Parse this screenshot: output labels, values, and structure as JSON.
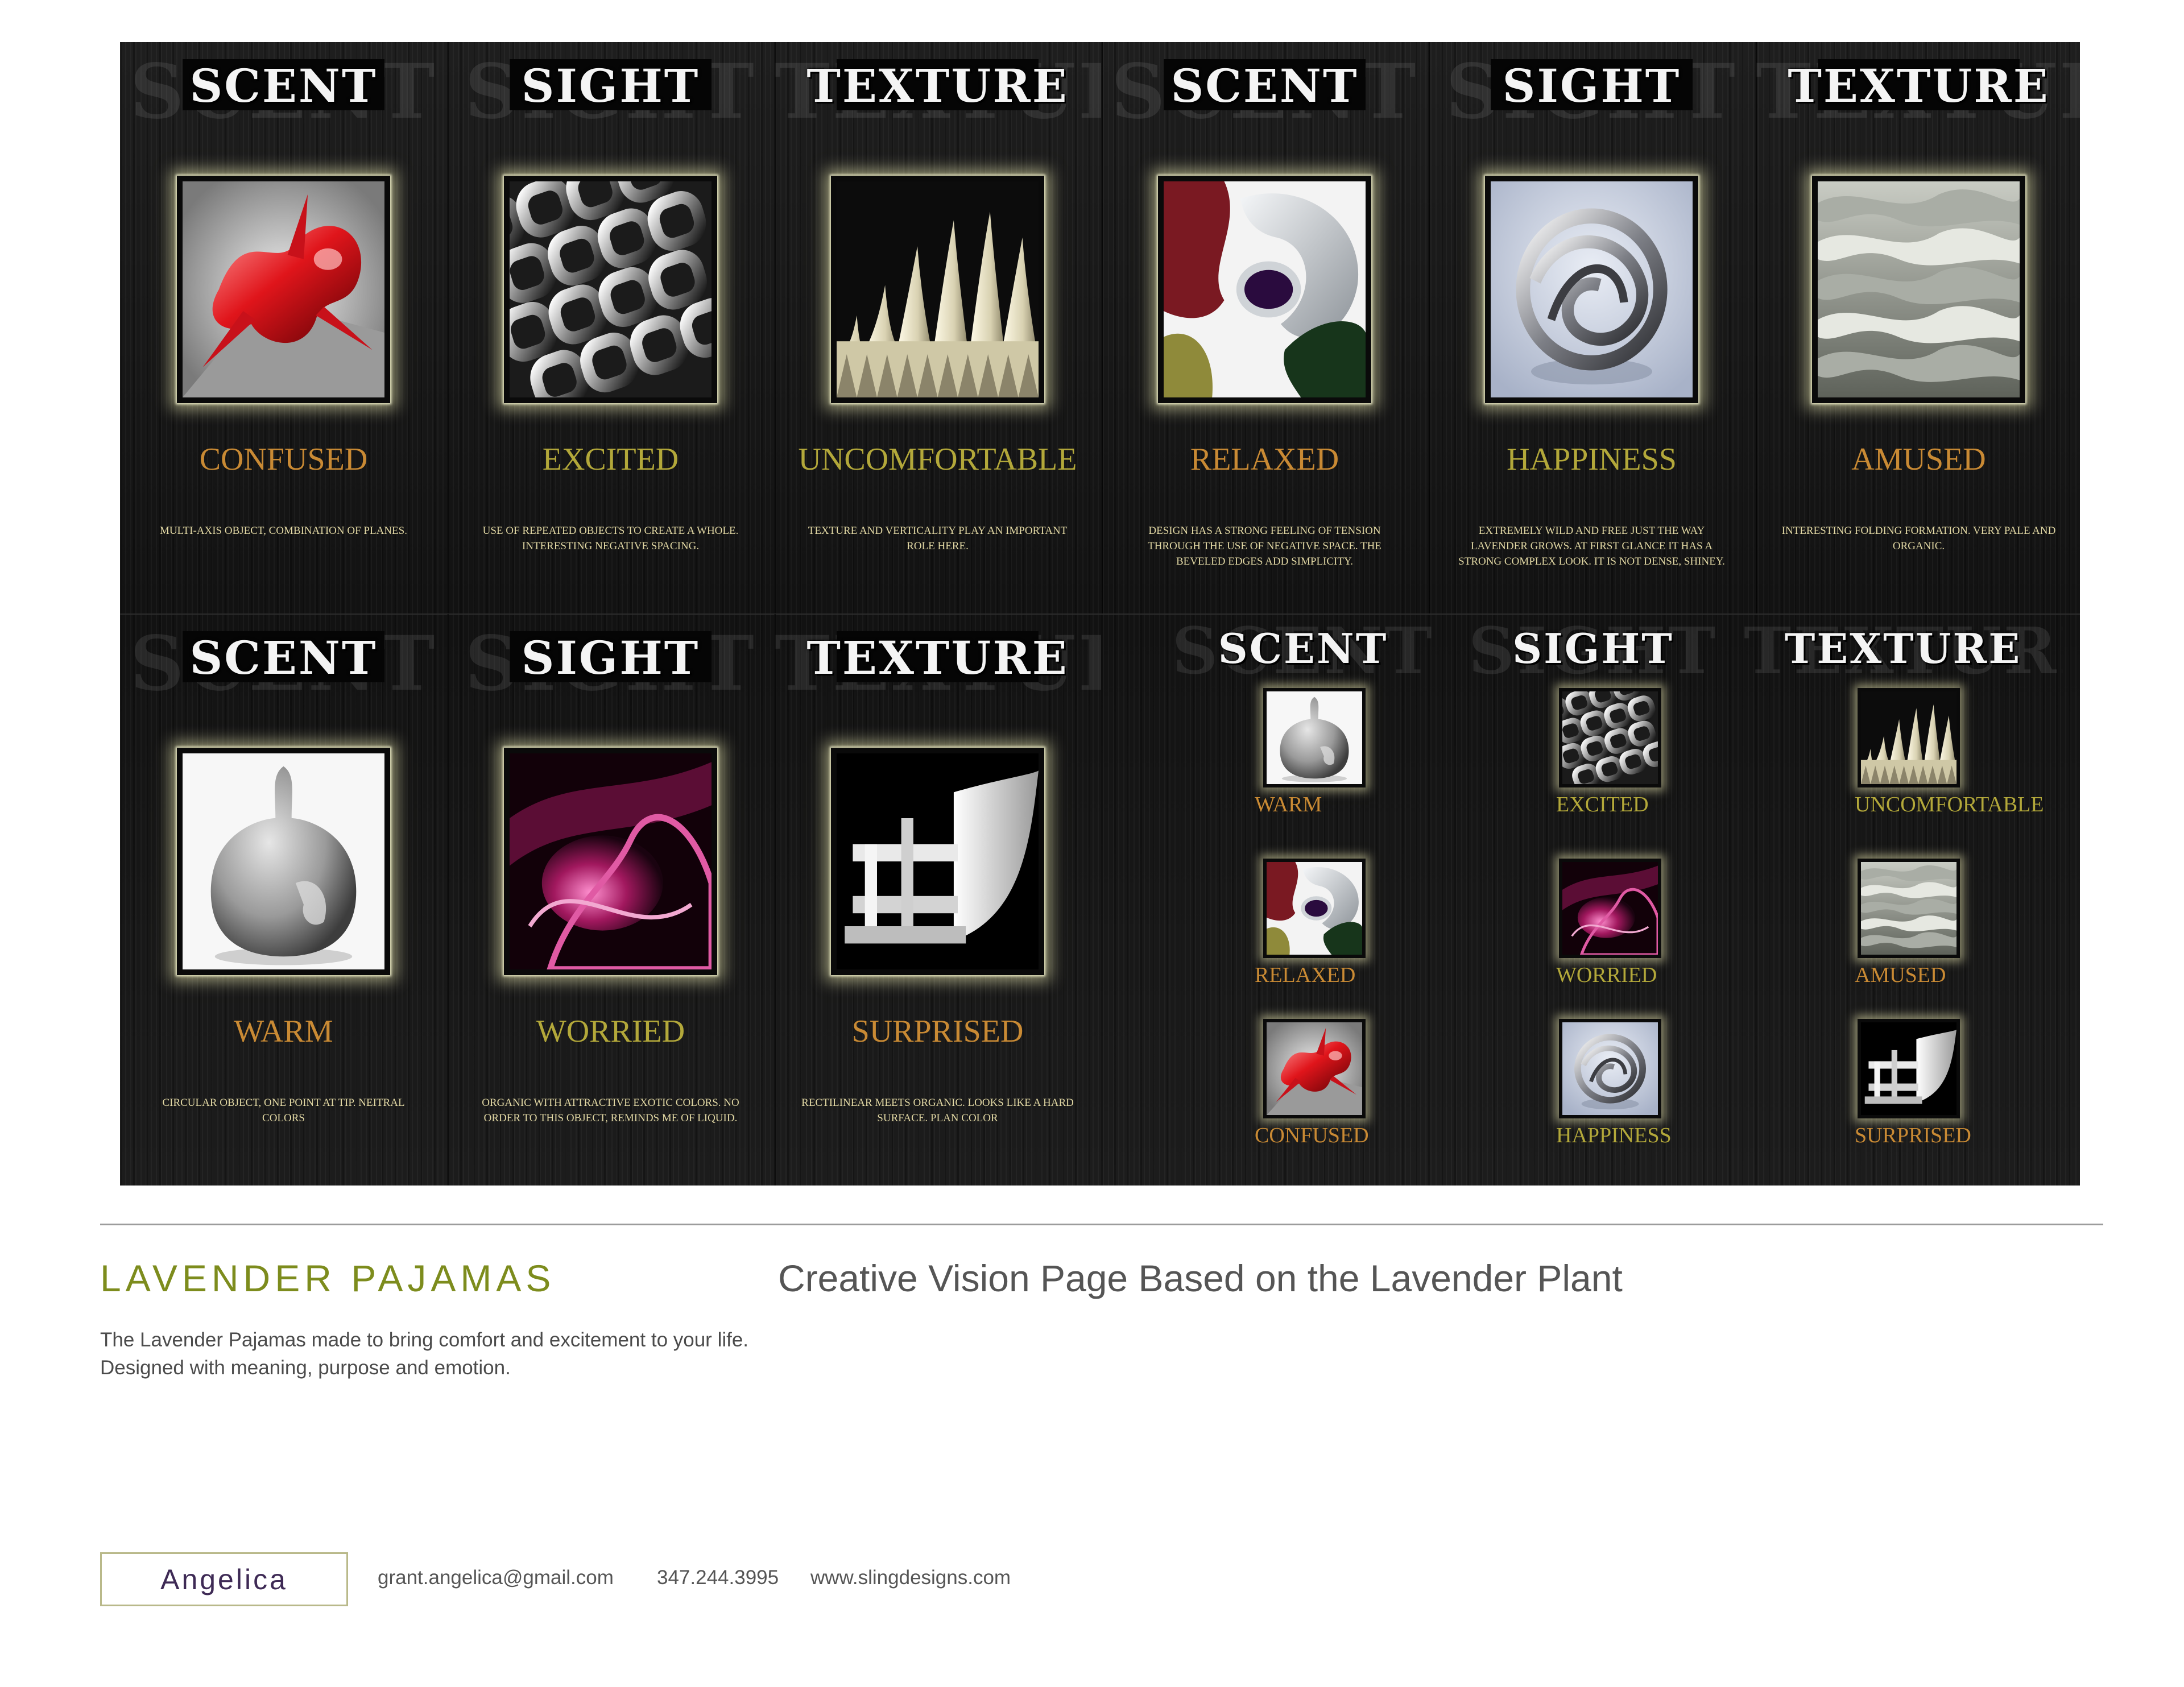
{
  "board": {
    "top_row": [
      {
        "category": "SCENT",
        "ghost": "SCENT",
        "emotion": "CONFUSED",
        "emotion_color": "#c98a34",
        "description": "MULTI-AXIS OBJECT, COMBINATION OF PLANES.",
        "art": "red-abstract-sculpture"
      },
      {
        "category": "SIGHT",
        "ghost": "SIGHT",
        "emotion": "EXCITED",
        "emotion_color": "#b3a83a",
        "description": "USE OF REPEATED OBJECTS TO CREATE A WHOLE. INTERESTING NEGATIVE SPACING.",
        "art": "chrome-lattice-sculpture"
      },
      {
        "category": "TEXTURE",
        "ghost": "TEXTURE",
        "emotion": "UNCOMFORTABLE",
        "emotion_color": "#b3a83a",
        "description": "TEXTURE AND VERTICALITY PLAY AN IMPORTANT ROLE HERE.",
        "art": "ivory-spikes-sculpture"
      },
      {
        "category": "SCENT",
        "ghost": "SCENT",
        "emotion": "RELAXED",
        "emotion_color": "#c98a34",
        "description": "DESIGN HAS A STRONG FEELING OF TENSION THROUGH THE USE OF NEGATIVE SPACE. THE BEVELED EDGES ADD SIMPLICITY.",
        "art": "glossy-curves-sculpture"
      },
      {
        "category": "SIGHT",
        "ghost": "SIGHT",
        "emotion": "HAPPINESS",
        "emotion_color": "#b3a83a",
        "description": "EXTREMELY WILD AND FREE JUST THE WAY LAVENDER GROWS. AT FIRST GLANCE IT HAS A STRONG COMPLEX LOOK. IT IS NOT DENSE, SHINEY.",
        "art": "chrome-sphere-sculpture"
      },
      {
        "category": "TEXTURE",
        "ghost": "TEXTURE",
        "emotion": "AMUSED",
        "emotion_color": "#c98a34",
        "description": "INTERESTING FOLDING FORMATION. VERY PALE AND ORGANIC.",
        "art": "pale-folds-sculpture"
      }
    ],
    "bottom_row": [
      {
        "category": "SCENT",
        "ghost": "SCENT",
        "emotion": "WARM",
        "emotion_color": "#c98a34",
        "description": "CIRCULAR OBJECT, ONE POINT AT TIP. NEITRAL COLORS",
        "art": "stone-gourd-sculpture"
      },
      {
        "category": "SIGHT",
        "ghost": "SIGHT",
        "emotion": "WORRIED",
        "emotion_color": "#b3a83a",
        "description": "ORGANIC WITH ATTRACTIVE EXOTIC COLORS. NO ORDER TO THIS OBJECT, REMINDS ME OF LIQUID.",
        "art": "pink-liquid-sculpture"
      },
      {
        "category": "TEXTURE",
        "ghost": "TEXTURE",
        "emotion": "SURPRISED",
        "emotion_color": "#c98a34",
        "description": "RECTILINEAR MEETS ORGANIC. LOOKS LIKE A HARD SURFACE. PLAN COLOR",
        "art": "white-shelf-sculpture"
      }
    ],
    "summary": [
      {
        "category": "SCENT",
        "ghost": "SCENT",
        "items": [
          {
            "label": "WARM",
            "color": "#c98a34",
            "art": "stone-gourd-sculpture"
          },
          {
            "label": "RELAXED",
            "color": "#c98a34",
            "art": "glossy-curves-sculpture"
          },
          {
            "label": "CONFUSED",
            "color": "#c98a34",
            "art": "red-abstract-sculpture"
          }
        ]
      },
      {
        "category": "SIGHT",
        "ghost": "SIGHT",
        "items": [
          {
            "label": "EXCITED",
            "color": "#b3a83a",
            "art": "chrome-lattice-sculpture"
          },
          {
            "label": "WORRIED",
            "color": "#b3a83a",
            "art": "pink-liquid-sculpture"
          },
          {
            "label": "HAPPINESS",
            "color": "#b3a83a",
            "art": "chrome-sphere-sculpture"
          }
        ]
      },
      {
        "category": "TEXTURE",
        "ghost": "TEXTURE",
        "items": [
          {
            "label": "UNCOMFORTABLE",
            "color": "#b3a83a",
            "art": "ivory-spikes-sculpture"
          },
          {
            "label": "AMUSED",
            "color": "#c98a34",
            "art": "pale-folds-sculpture"
          },
          {
            "label": "SURPRISED",
            "color": "#c98a34",
            "art": "white-shelf-sculpture"
          }
        ]
      }
    ]
  },
  "footer": {
    "project_title": "LAVENDER PAJAMAS",
    "vision_title": "Creative Vision Page Based on the Lavender Plant",
    "description": "The Lavender Pajamas made to bring comfort and excitement to your life.  Designed with meaning, purpose and emotion.",
    "name": "Angelica",
    "email": "grant.angelica@gmail.com",
    "phone": "347.244.3995",
    "website": "www.slingdesigns.com"
  },
  "colors": {
    "board_bg": "#161616",
    "title_green": "#7d8c1d",
    "name_purple": "#3e2a55",
    "gold": "#c98a34",
    "olive": "#b3a83a"
  }
}
